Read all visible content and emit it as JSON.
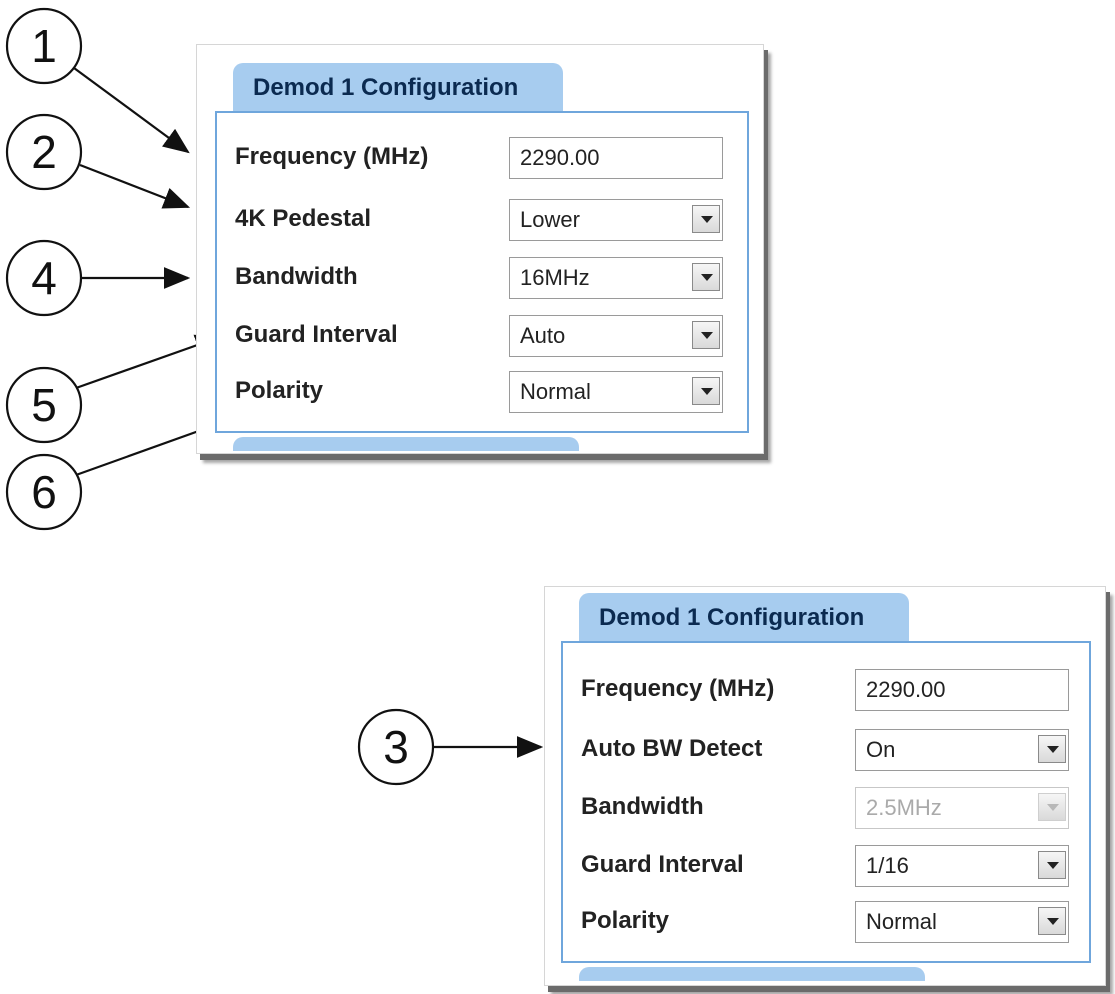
{
  "callouts": [
    "1",
    "2",
    "3",
    "4",
    "5",
    "6"
  ],
  "panel_a": {
    "tab_title": "Demod 1 Configuration",
    "rows": [
      {
        "label": "Frequency (MHz)",
        "value": "2290.00"
      },
      {
        "label": "4K Pedestal",
        "value": "Lower"
      },
      {
        "label": "Bandwidth",
        "value": "16MHz"
      },
      {
        "label": "Guard Interval",
        "value": "Auto"
      },
      {
        "label": "Polarity",
        "value": "Normal"
      }
    ]
  },
  "panel_b": {
    "tab_title": "Demod 1 Configuration",
    "rows": [
      {
        "label": "Frequency (MHz)",
        "value": "2290.00"
      },
      {
        "label": "Auto BW Detect",
        "value": "On"
      },
      {
        "label": "Bandwidth",
        "value": "2.5MHz"
      },
      {
        "label": "Guard Interval",
        "value": "1/16"
      },
      {
        "label": "Polarity",
        "value": "Normal"
      }
    ]
  },
  "colors": {
    "tab": "#a7ccef",
    "frame": "#6fa6dc",
    "disabled_text": "#aaaaaa"
  }
}
